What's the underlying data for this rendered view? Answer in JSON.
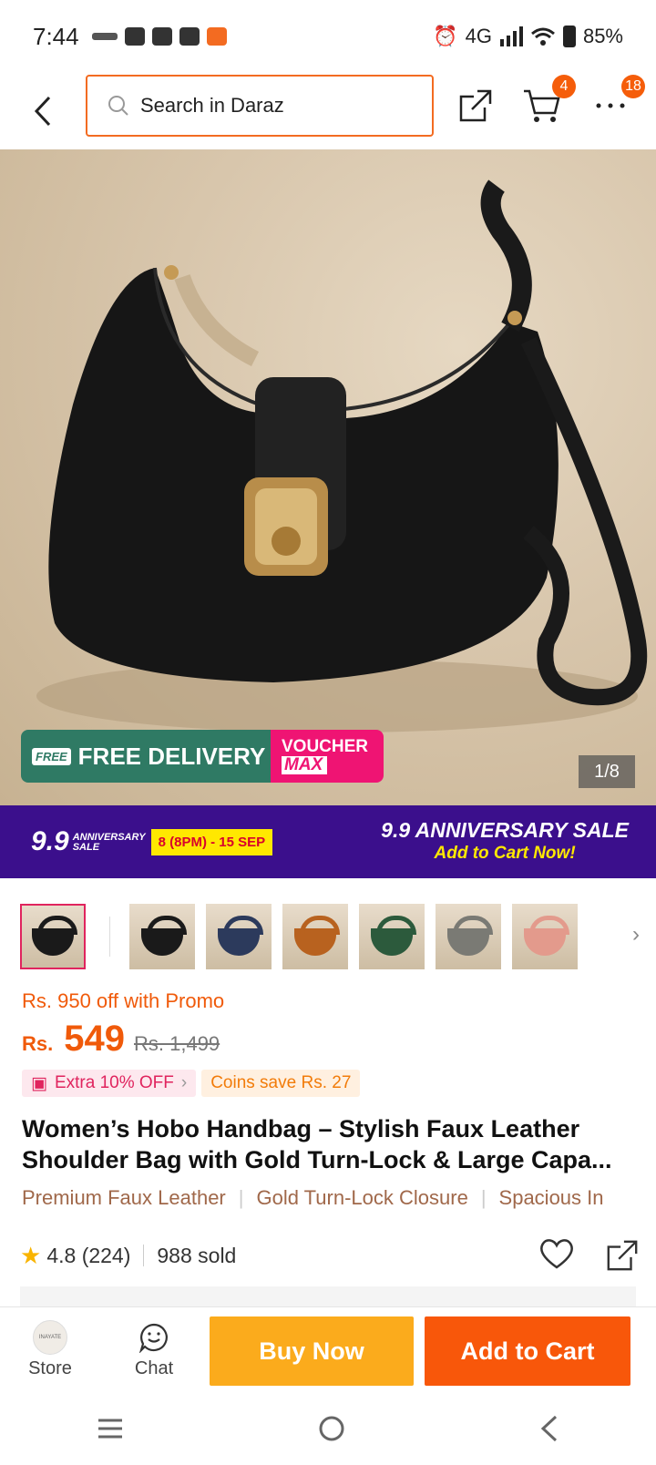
{
  "status_bar": {
    "time": "7:44",
    "battery": "85%",
    "network": "4G"
  },
  "header": {
    "search_placeholder": "Search in Daraz",
    "cart_count": "4",
    "more_count": "18"
  },
  "hero": {
    "free_delivery_tag": "FREE",
    "free_delivery": "FREE DELIVERY",
    "voucher_line1": "VOUCHER",
    "voucher_line2": "MAX",
    "image_counter": "1/8"
  },
  "promo_banner": {
    "logo": "9.9",
    "logo_sub1": "ANNIVERSARY",
    "logo_sub2": "SALE",
    "dates": "8 (8PM) - 15 SEP",
    "title": "9.9 ANNIVERSARY SALE",
    "subtitle": "Add to Cart Now!"
  },
  "thumbnails": [
    {
      "color": "#1a1a1a"
    },
    {
      "color": "#1a1a1a"
    },
    {
      "color": "#2c3a5c"
    },
    {
      "color": "#b8621f"
    },
    {
      "color": "#2c5a3c"
    },
    {
      "color": "#7a7a74"
    },
    {
      "color": "#e39a8c"
    }
  ],
  "price": {
    "promo_text": "Rs. 950 off with Promo",
    "currency": "Rs.",
    "amount": "549",
    "original": "Rs. 1,499",
    "extra_off": "Extra 10% OFF",
    "coins": "Coins save Rs. 27"
  },
  "product": {
    "title_line1": "Women’s Hobo Handbag – Stylish Faux Leather",
    "title_line2": "Shoulder Bag with Gold Turn-Lock & Large Capa...",
    "features": [
      "Premium Faux Leather",
      "Gold Turn-Lock Closure",
      "Spacious In"
    ],
    "rating": "4.8",
    "reviews": "(224)",
    "sold": "988 sold"
  },
  "bottom_bar": {
    "store_label": "Store",
    "store_logo_text": "INAYATE",
    "chat_label": "Chat",
    "buy_now": "Buy Now",
    "add_to_cart": "Add to Cart"
  },
  "colors": {
    "accent": "#f36b21",
    "buy_now": "#fbab1c",
    "add_to_cart": "#f8570a",
    "promo_bg": "#3b0f8c"
  }
}
